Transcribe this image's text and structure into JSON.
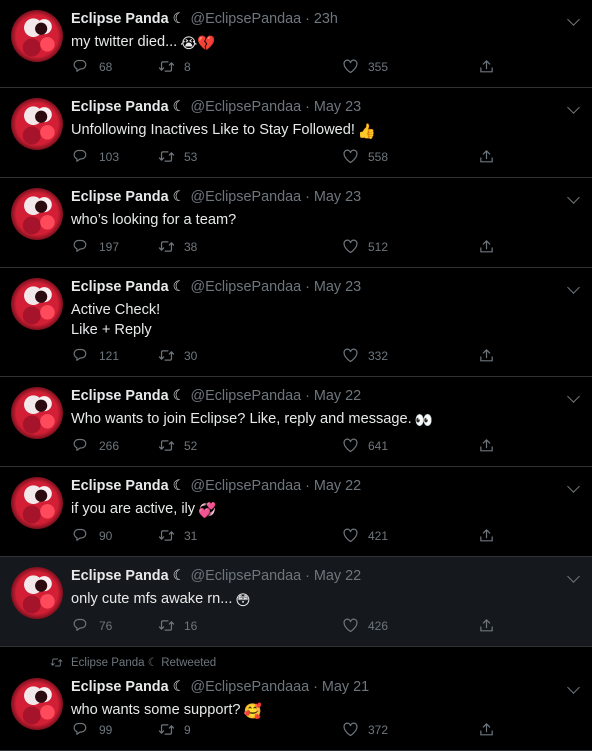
{
  "feed": {
    "tweets": [
      {
        "name": "Eclipse Panda",
        "moon": "☾",
        "handle": "@EclipsePandaa",
        "time": "23h",
        "text": "my twitter died...",
        "emojis": "😭💔",
        "replies": "68",
        "retweets": "8",
        "likes": "355"
      },
      {
        "name": "Eclipse Panda",
        "moon": "☾",
        "handle": "@EclipsePandaa",
        "time": "May 23",
        "text": "Unfollowing Inactives Like to Stay Followed!",
        "emojis": "👍",
        "replies": "103",
        "retweets": "53",
        "likes": "558"
      },
      {
        "name": "Eclipse Panda",
        "moon": "☾",
        "handle": "@EclipsePandaa",
        "time": "May 23",
        "text": "who’s looking for a team?",
        "emojis": "",
        "replies": "197",
        "retweets": "38",
        "likes": "512"
      },
      {
        "name": "Eclipse Panda",
        "moon": "☾",
        "handle": "@EclipsePandaa",
        "time": "May 23",
        "text": "Active Check!\nLike + Reply",
        "emojis": "",
        "replies": "121",
        "retweets": "30",
        "likes": "332"
      },
      {
        "name": "Eclipse Panda",
        "moon": "☾",
        "handle": "@EclipsePandaa",
        "time": "May 22",
        "text": "Who wants to join Eclipse? Like, reply and message.",
        "emojis": "👀",
        "replies": "266",
        "retweets": "52",
        "likes": "641"
      },
      {
        "name": "Eclipse Panda",
        "moon": "☾",
        "handle": "@EclipsePandaa",
        "time": "May 22",
        "text": "if you are active, ily",
        "emojis": "💞",
        "replies": "90",
        "retweets": "31",
        "likes": "421"
      },
      {
        "name": "Eclipse Panda",
        "moon": "☾",
        "handle": "@EclipsePandaa",
        "time": "May 22",
        "text": "only cute mfs awake rn...",
        "emojis": "😳",
        "replies": "76",
        "retweets": "16",
        "likes": "426"
      },
      {
        "name": "Eclipse Panda",
        "moon": "☾",
        "handle": "@EclipsePandaaa",
        "time": "May 21",
        "text": "who wants some support?",
        "emojis": "🥰",
        "replies": "99",
        "retweets": "9",
        "likes": "372",
        "retweeted_by": "Eclipse Panda ☾ Retweeted"
      }
    ]
  }
}
